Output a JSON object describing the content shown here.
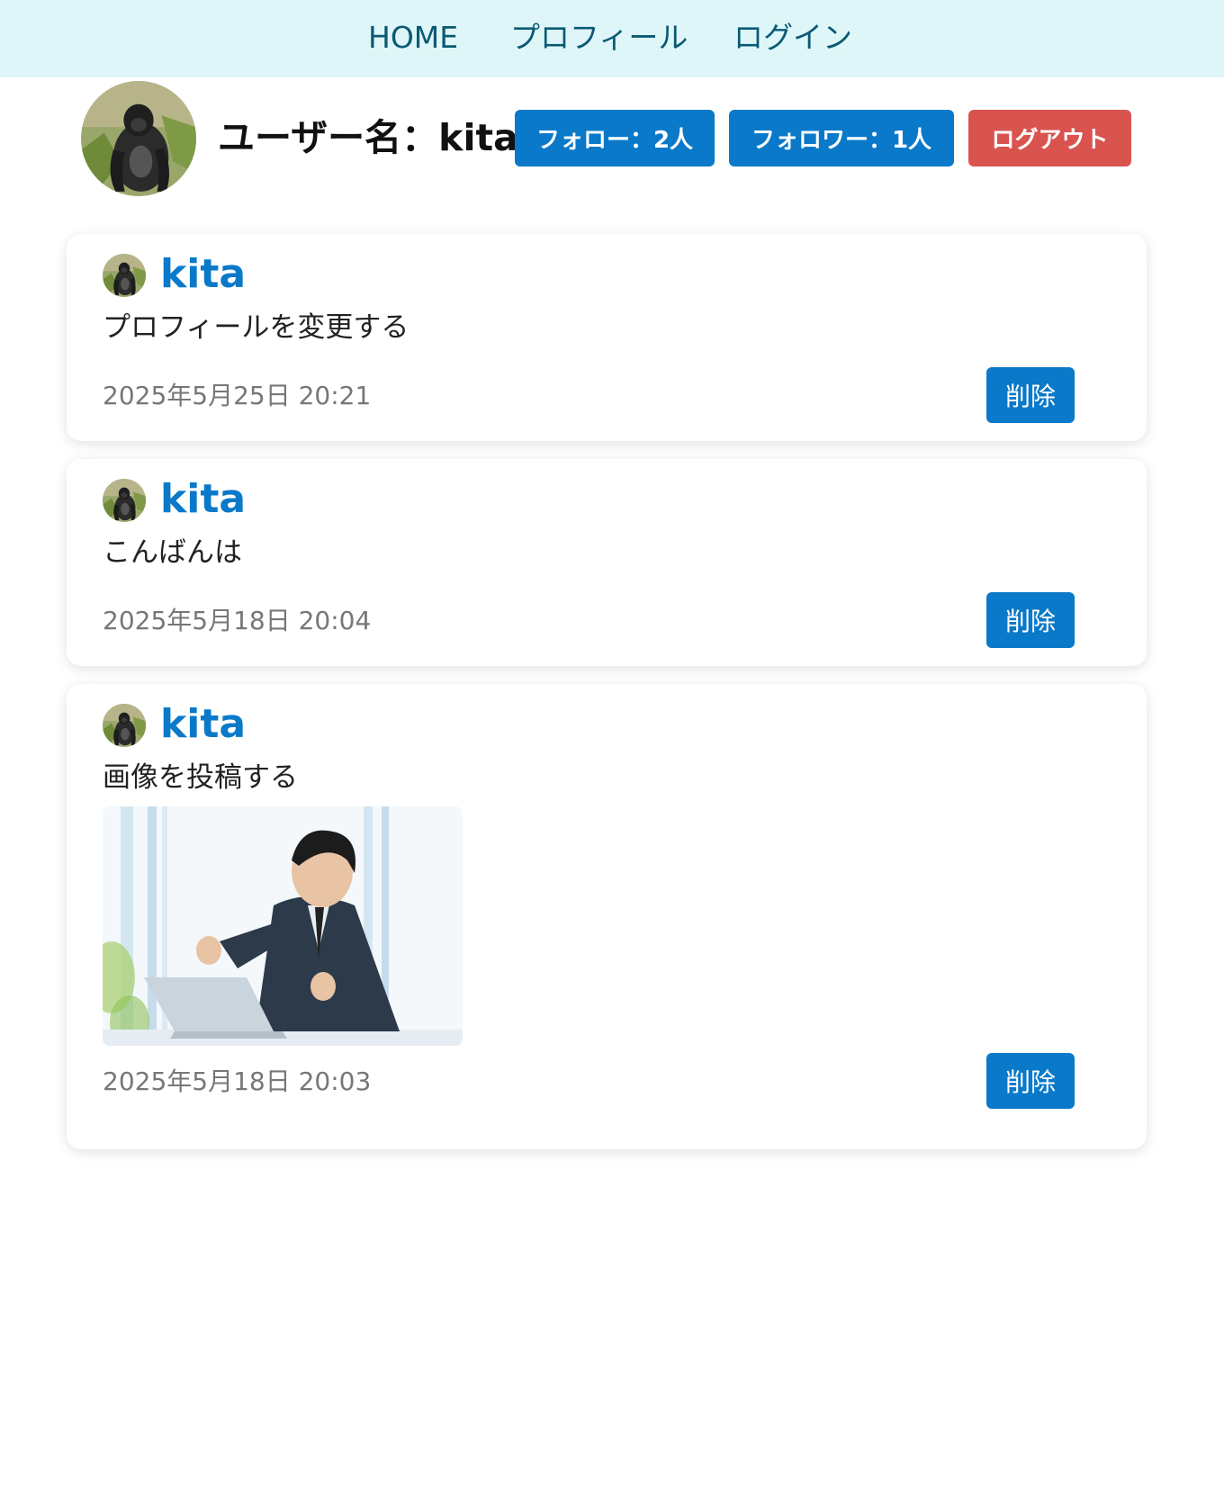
{
  "nav": {
    "home": "HOME",
    "profile": "プロフィール",
    "login": "ログイン"
  },
  "profile": {
    "username_label": "ユーザー名：kita",
    "follow_label": "フォロー：2人",
    "follower_label": "フォロワー：1人",
    "logout_label": "ログアウト"
  },
  "posts": [
    {
      "author": "kita",
      "body": "プロフィールを変更する",
      "date": "2025年5月25日 20:21",
      "delete_label": "削除"
    },
    {
      "author": "kita",
      "body": "こんばんは",
      "date": "2025年5月18日 20:04",
      "delete_label": "削除"
    },
    {
      "author": "kita",
      "body": "画像を投稿する",
      "date": "2025年5月18日 20:03",
      "delete_label": "削除",
      "image": "businessman-at-laptop-photo"
    }
  ],
  "colors": {
    "nav_bg": "#dff6f9",
    "nav_text": "#0a5a74",
    "accent": "#0a79c9",
    "danger": "#d9534f",
    "date_text": "#777777"
  }
}
